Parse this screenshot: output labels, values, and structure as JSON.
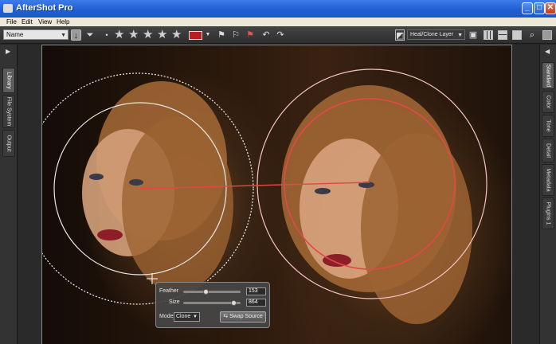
{
  "window": {
    "title": "AfterShot Pro",
    "minimize_glyph": "_",
    "maximize_glyph": "□",
    "close_glyph": "✕"
  },
  "menu": {
    "items": [
      "File",
      "Edit",
      "View",
      "Help"
    ]
  },
  "toolbar": {
    "sort_value": "Name",
    "rating_stars": 5,
    "layer_value": "Heal/Clone Layer",
    "accent_color": "#b81f1f"
  },
  "left_tabs": [
    "Library",
    "File System",
    "Output"
  ],
  "right_tabs": [
    "Standard",
    "Color",
    "Tone",
    "Detail",
    "Metadata",
    "Plugins 1"
  ],
  "heal_palette": {
    "feather_label": "Feather",
    "feather_value": "153",
    "size_label": "Size",
    "size_value": "864",
    "mode_label": "Mode",
    "mode_value": "Clone",
    "swap_label": "Swap Source"
  }
}
